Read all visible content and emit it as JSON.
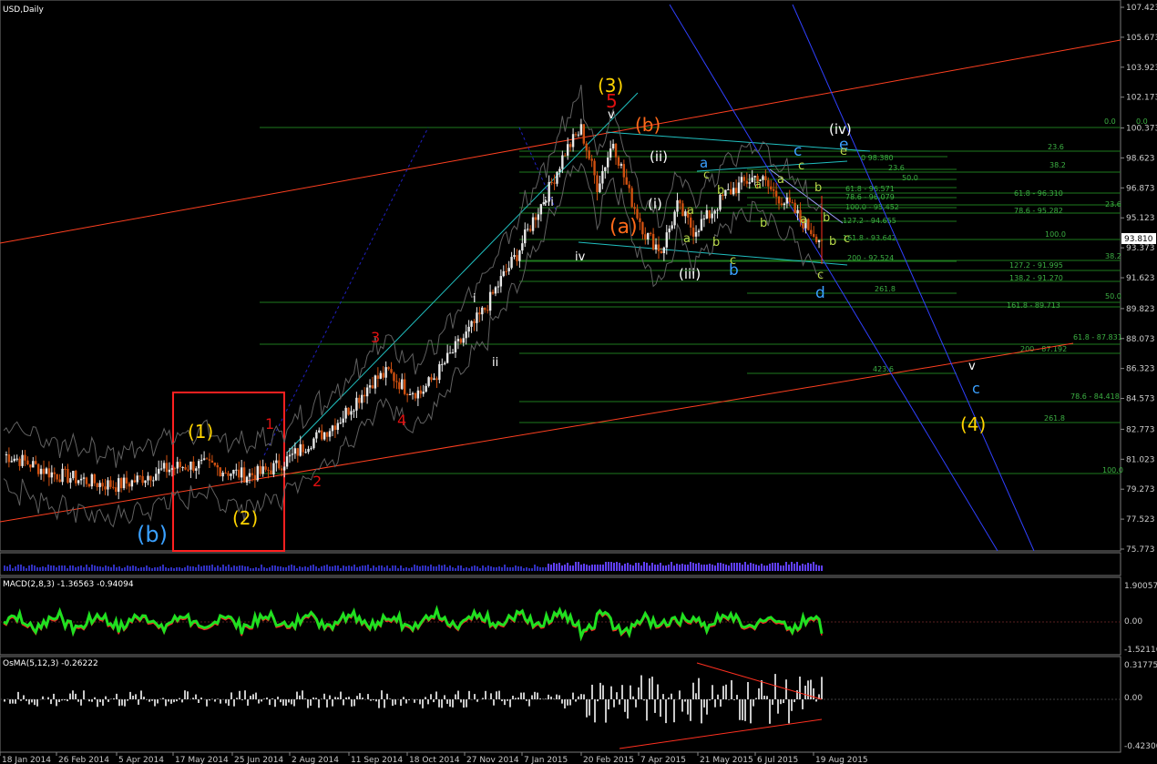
{
  "window": {
    "symbol_label": "USD,Daily"
  },
  "indicators": {
    "macd_label": "MACD(2,8,3) -1.36563 -0.94094",
    "osma_label": "OsMA(5,12,3) -0.26222",
    "macd_ticks": [
      "1.90057",
      "0.00",
      "-1.52116"
    ],
    "osma_ticks": [
      "0.31775",
      "0.00",
      "-0.42300"
    ]
  },
  "chart_data": {
    "type": "line",
    "title": "USD,Daily",
    "x": [
      "18 Jan 2014",
      "26 Feb 2014",
      "5 Apr 2014",
      "17 May 2014",
      "25 Jun 2014",
      "2 Aug 2014",
      "11 Sep 2014",
      "18 Oct 2014",
      "27 Nov 2014",
      "7 Jan 2015",
      "20 Feb 2015",
      "7 Apr 2015",
      "21 May 2015",
      "6 Jul 2015",
      "19 Aug 2015"
    ],
    "ylim": [
      75.773,
      107.423
    ],
    "price_ticks": [
      "107.423",
      "105.673",
      "103.923",
      "102.173",
      "100.373",
      "98.623",
      "96.873",
      "95.123",
      "93.373",
      "91.623",
      "89.823",
      "88.073",
      "86.323",
      "84.573",
      "82.773",
      "81.023",
      "79.273",
      "77.523",
      "75.773"
    ],
    "current_price": "93.810",
    "series": [
      {
        "values": [
          81.3,
          81.0,
          80.6,
          80.2,
          80.0,
          79.8,
          79.6,
          79.5,
          79.7,
          80.1,
          80.4,
          80.6,
          80.7,
          80.6,
          80.3,
          80.1,
          80.2,
          80.6,
          81.2,
          82.0,
          82.6,
          83.4,
          84.5,
          85.6,
          86.1,
          85.2,
          84.9,
          86.0,
          87.3,
          88.5,
          89.8,
          91.5,
          93.0,
          95.0,
          96.8,
          99.0,
          100.3,
          97.0,
          99.6,
          96.5,
          94.2,
          93.2,
          95.8,
          94.4,
          95.3,
          96.5,
          97.1,
          97.6,
          96.6,
          95.8,
          94.7,
          93.81
        ]
      }
    ],
    "wave_labels": [
      {
        "text": "(3)",
        "color": "#ffd400",
        "size": 20
      },
      {
        "text": "5",
        "color": "#e01010",
        "size": 20
      },
      {
        "text": "v",
        "color": "#ffffff",
        "size": 13
      },
      {
        "text": "(b)",
        "color": "#ff6a1a",
        "size": 20
      },
      {
        "text": "(a)",
        "color": "#ff6a1a",
        "size": 22
      },
      {
        "text": "(ii)",
        "color": "#ffffff",
        "size": 15
      },
      {
        "text": "(i)",
        "color": "#ffffff",
        "size": 15
      },
      {
        "text": "(iii)",
        "color": "#ffffff",
        "size": 15
      },
      {
        "text": "(iv)",
        "color": "#ffffff",
        "size": 15
      },
      {
        "text": "iii",
        "color": "#ffffff",
        "size": 13
      },
      {
        "text": "iv",
        "color": "#ffffff",
        "size": 13
      },
      {
        "text": "i",
        "color": "#ffffff",
        "size": 13
      },
      {
        "text": "ii",
        "color": "#ffffff",
        "size": 13
      },
      {
        "text": "3",
        "color": "#e01010",
        "size": 16
      },
      {
        "text": "4",
        "color": "#e01010",
        "size": 16
      },
      {
        "text": "1",
        "color": "#e01010",
        "size": 16
      },
      {
        "text": "2",
        "color": "#e01010",
        "size": 16
      },
      {
        "text": "(1)",
        "color": "#ffd400",
        "size": 20
      },
      {
        "text": "(2)",
        "color": "#ffd400",
        "size": 20
      },
      {
        "text": "(b)",
        "color": "#3aa0ff",
        "size": 24
      },
      {
        "text": "(4)",
        "color": "#ffd400",
        "size": 20
      },
      {
        "text": "v",
        "color": "#ffffff",
        "size": 13
      },
      {
        "text": "c",
        "color": "#3aa0ff",
        "size": 16
      },
      {
        "text": "c",
        "color": "#3aa0ff",
        "size": 17
      },
      {
        "text": "e",
        "color": "#3aa0ff",
        "size": 17
      },
      {
        "text": "d",
        "color": "#3aa0ff",
        "size": 17
      },
      {
        "text": "b",
        "color": "#3aa0ff",
        "size": 17
      },
      {
        "text": "a",
        "color": "#3aa0ff",
        "size": 15
      },
      {
        "text": "c",
        "color": "#b8d84a",
        "size": 13
      },
      {
        "text": "a",
        "color": "#b8d84a",
        "size": 13
      },
      {
        "text": "b",
        "color": "#b8d84a",
        "size": 13
      },
      {
        "text": "c",
        "color": "#b8d84a",
        "size": 13
      },
      {
        "text": "b",
        "color": "#b8d84a",
        "size": 13
      },
      {
        "text": "a",
        "color": "#b8d84a",
        "size": 13
      },
      {
        "text": "b",
        "color": "#b8d84a",
        "size": 13
      },
      {
        "text": "a",
        "color": "#b8d84a",
        "size": 13
      },
      {
        "text": "c",
        "color": "#b8d84a",
        "size": 13
      },
      {
        "text": "a",
        "color": "#b8d84a",
        "size": 13
      },
      {
        "text": "b",
        "color": "#b8d84a",
        "size": 13
      },
      {
        "text": "a",
        "color": "#b8d84a",
        "size": 13
      },
      {
        "text": "b",
        "color": "#b8d84a",
        "size": 13
      },
      {
        "text": "e",
        "color": "#b8d84a",
        "size": 13
      },
      {
        "text": "c",
        "color": "#b8d84a",
        "size": 13
      },
      {
        "text": "b",
        "color": "#b8d84a",
        "size": 13
      },
      {
        "text": "c",
        "color": "#b8d84a",
        "size": 13
      }
    ],
    "fib_labels": [
      {
        "text": "0.0",
        "color": "#3cb043"
      },
      {
        "text": "0.0",
        "color": "#3cb043"
      },
      {
        "text": "23.6",
        "color": "#3cb043"
      },
      {
        "text": "0 98.380",
        "color": "#3cb043"
      },
      {
        "text": "23.6",
        "color": "#3cb043"
      },
      {
        "text": "38.2",
        "color": "#3cb043"
      },
      {
        "text": "50.0",
        "color": "#3cb043"
      },
      {
        "text": "61.8 - 96.571",
        "color": "#3cb043"
      },
      {
        "text": "61.8 - 96.310",
        "color": "#3cb043"
      },
      {
        "text": "78.6 - 96.079",
        "color": "#3cb043"
      },
      {
        "text": "100.0 - 95.452",
        "color": "#3cb043"
      },
      {
        "text": "78.6 - 95.282",
        "color": "#3cb043"
      },
      {
        "text": "23.6",
        "color": "#3cb043"
      },
      {
        "text": "127.2 - 94.655",
        "color": "#3cb043"
      },
      {
        "text": "161.8 - 93.642",
        "color": "#3cb043"
      },
      {
        "text": "100.0",
        "color": "#3cb043"
      },
      {
        "text": "38.2",
        "color": "#3cb043"
      },
      {
        "text": "200 - 92.524",
        "color": "#3cb043"
      },
      {
        "text": "127.2 - 91.995",
        "color": "#3cb043"
      },
      {
        "text": "138.2 - 91.270",
        "color": "#3cb043"
      },
      {
        "text": "261.8",
        "color": "#3cb043"
      },
      {
        "text": "50.0",
        "color": "#3cb043"
      },
      {
        "text": "161.8 - 89.713",
        "color": "#3cb043"
      },
      {
        "text": "61.8 - 87.831",
        "color": "#3cb043"
      },
      {
        "text": "200 - 87.192",
        "color": "#3cb043"
      },
      {
        "text": "423.6",
        "color": "#3cb043"
      },
      {
        "text": "78.6 - 84.418",
        "color": "#3cb043"
      },
      {
        "text": "261.8",
        "color": "#3cb043"
      },
      {
        "text": "100.0",
        "color": "#3cb043"
      }
    ],
    "colors": {
      "candle_up": "#e8e8e8",
      "candle_down": "#d05010",
      "channel": "#ff4020",
      "trend_blue": "#3040ff",
      "box": "#ff2020",
      "fib": "#1e7a1e",
      "macd_main": "#20e020",
      "macd_signal": "#ff2020",
      "band": "#606060"
    }
  }
}
